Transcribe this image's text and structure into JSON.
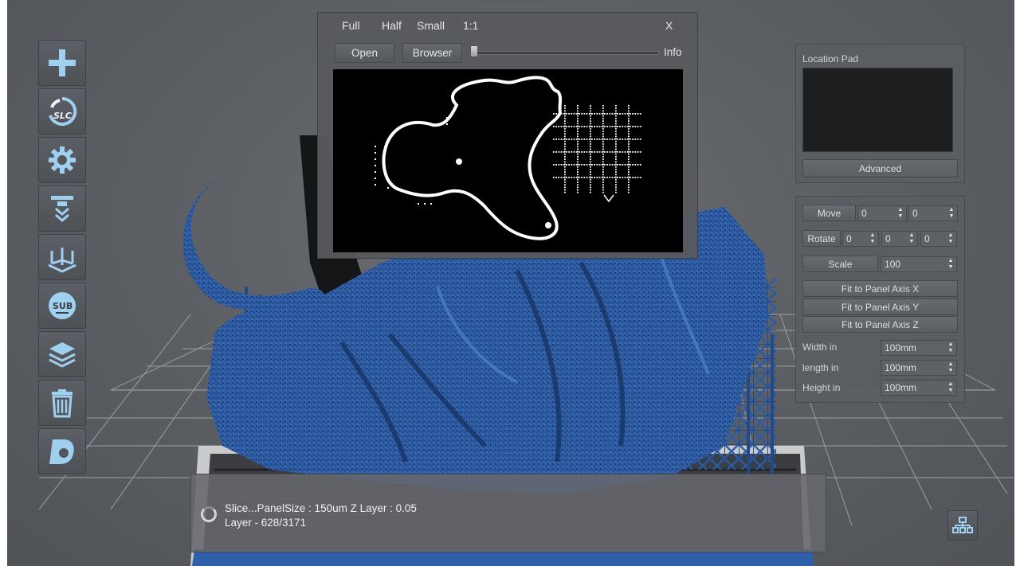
{
  "preview": {
    "menu": {
      "full": "Full",
      "half": "Half",
      "small": "Small",
      "one_to_one": "1:1",
      "close": "X"
    },
    "open_label": "Open",
    "browser_label": "Browser",
    "info_label": "Info",
    "slider_value": 0
  },
  "location_pad": {
    "title": "Location Pad",
    "advanced_label": "Advanced"
  },
  "transform": {
    "move_label": "Move",
    "move_values": [
      "0",
      "0"
    ],
    "rotate_label": "Rotate",
    "rotate_values": [
      "0",
      "0",
      "0"
    ],
    "scale_label": "Scale",
    "scale_value": "100",
    "fit_x": "Fit to Panel Axis X",
    "fit_y": "Fit to Panel Axis Y",
    "fit_z": "Fit to Panel Axis Z",
    "width_label": "Width in",
    "width_value": "100mm",
    "length_label": "length in",
    "length_value": "100mm",
    "height_label": "Height in",
    "height_value": "100mm"
  },
  "status": {
    "line1": "Slice...PanelSize : 150um  Z Layer : 0.05",
    "line2": "Layer - 628/3171"
  },
  "toolbar": {
    "slc_text": "SLC",
    "sub_text": "SUB"
  },
  "colors": {
    "model_blue": "#2f5fa8",
    "panel_bg": "#5a5d62",
    "accent_icon": "#8fc3e6"
  }
}
